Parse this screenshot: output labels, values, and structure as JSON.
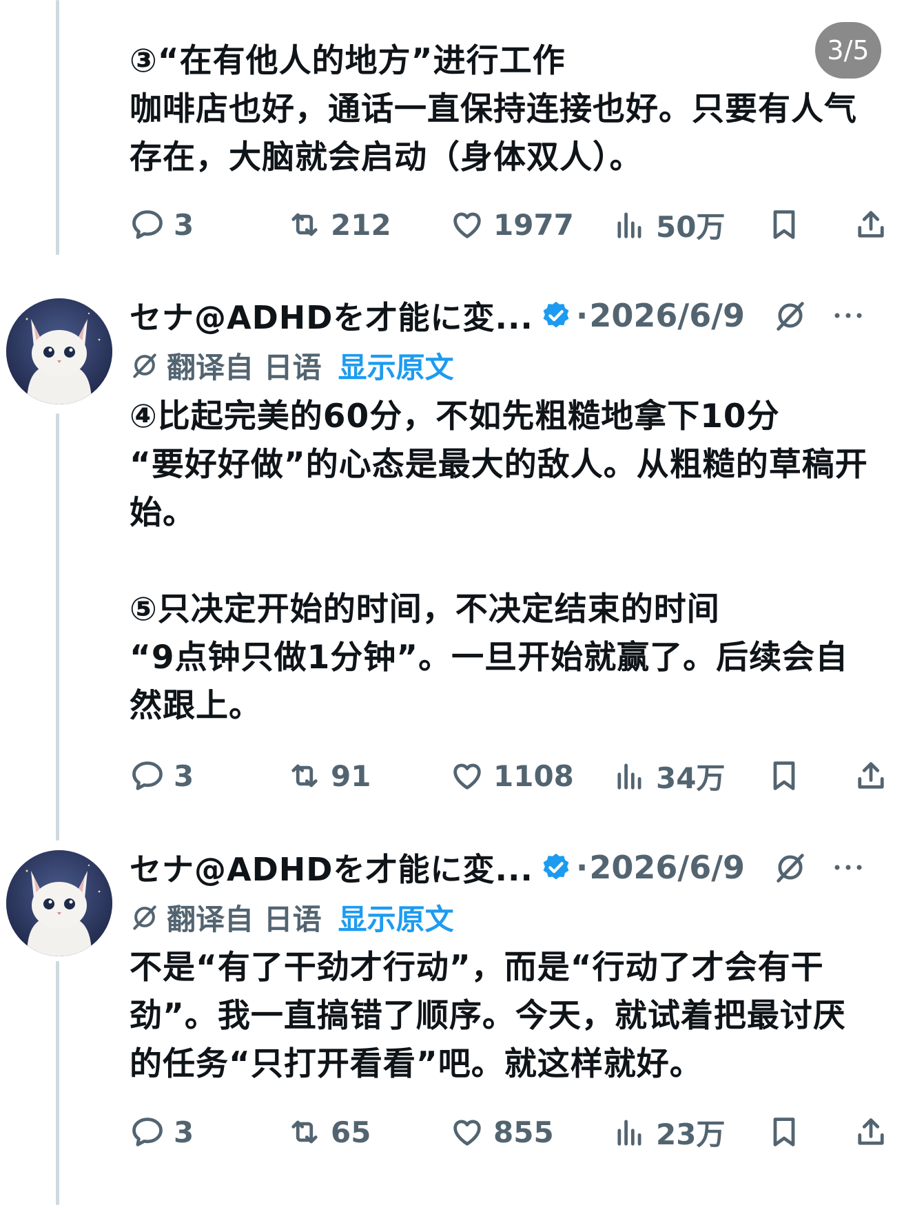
{
  "pager": {
    "label": "3/5"
  },
  "tweets": [
    {
      "paragraphs": [
        "③“在有他人的地方”进行工作",
        "咖啡店也好，通话一直保持连接也好。只要有人气存在，大脑就会启动（身体双人）。"
      ],
      "stats": {
        "replies": "3",
        "retweets": "212",
        "likes": "1977",
        "views": "50万"
      }
    },
    {
      "author": "セナ@ADHDを才能に変...",
      "date": "2026/6/9",
      "date_sep": "·",
      "translated_label": "翻译自 日语",
      "show_original": "显示原文",
      "paragraphs": [
        "④比起完美的60分，不如先粗糙地拿下10分",
        "“要好好做”的心态是最大的敌人。从粗糙的草稿开始。",
        "",
        "⑤只决定开始的时间，不决定结束的时间",
        "“9点钟只做1分钟”。一旦开始就赢了。后续会自然跟上。"
      ],
      "stats": {
        "replies": "3",
        "retweets": "91",
        "likes": "1108",
        "views": "34万"
      }
    },
    {
      "author": "セナ@ADHDを才能に変...",
      "date": "2026/6/9",
      "date_sep": "·",
      "translated_label": "翻译自 日语",
      "show_original": "显示原文",
      "paragraphs": [
        "不是“有了干劲才行动”，而是“行动了才会有干劲”。我一直搞错了顺序。今天，就试着把最讨厌的任务“只打开看看”吧。就这样就好。"
      ],
      "stats": {
        "replies": "3",
        "retweets": "65",
        "likes": "855",
        "views": "23万"
      }
    }
  ],
  "icons": {
    "reply": "speech-bubble-icon",
    "retweet": "retweet-arrows-icon",
    "like": "heart-icon",
    "views": "bar-chart-icon",
    "bookmark": "bookmark-icon",
    "share": "share-upload-icon",
    "verified": "verified-badge-icon",
    "grok": "grok-slash-circle-icon",
    "more": "more-dots-icon",
    "translate": "translate-icon"
  },
  "colors": {
    "text": "#0f1419",
    "muted": "#536471",
    "link": "#1d9bf0",
    "verified": "#1d9bf0",
    "thread_line": "#cfd9de",
    "pager_bg": "#8a8a8a"
  }
}
